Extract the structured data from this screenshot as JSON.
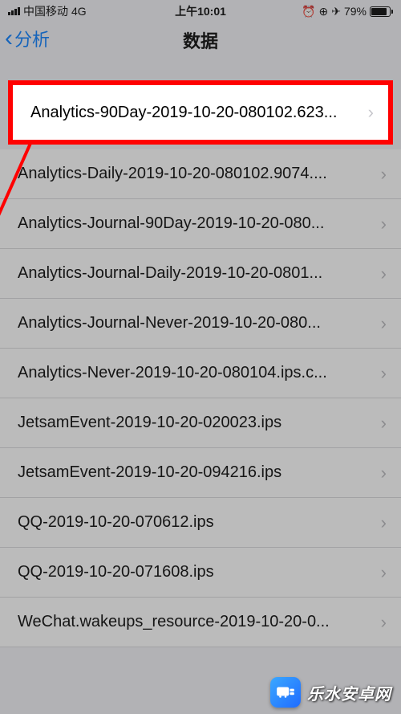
{
  "statusbar": {
    "carrier": "中国移动",
    "network": "4G",
    "time": "上午10:01",
    "battery_pct": "79%",
    "icons": {
      "alarm": "⏰",
      "orientation": "⊕",
      "location": "➤"
    }
  },
  "header": {
    "back_label": "分析",
    "title": "数据"
  },
  "highlighted_row": {
    "label": "Analytics-90Day-2019-10-20-080102.623..."
  },
  "rows": [
    {
      "label": "Analytics-Daily-2019-10-20-080102.9074...."
    },
    {
      "label": "Analytics-Journal-90Day-2019-10-20-080..."
    },
    {
      "label": "Analytics-Journal-Daily-2019-10-20-0801..."
    },
    {
      "label": "Analytics-Journal-Never-2019-10-20-080..."
    },
    {
      "label": "Analytics-Never-2019-10-20-080104.ips.c..."
    },
    {
      "label": "JetsamEvent-2019-10-20-020023.ips"
    },
    {
      "label": "JetsamEvent-2019-10-20-094216.ips"
    },
    {
      "label": "QQ-2019-10-20-070612.ips"
    },
    {
      "label": "QQ-2019-10-20-071608.ips"
    },
    {
      "label": "WeChat.wakeups_resource-2019-10-20-0..."
    }
  ],
  "watermark": {
    "text": "乐水安卓网"
  },
  "colors": {
    "ios_blue": "#007aff",
    "highlight_red": "#ff0000"
  }
}
